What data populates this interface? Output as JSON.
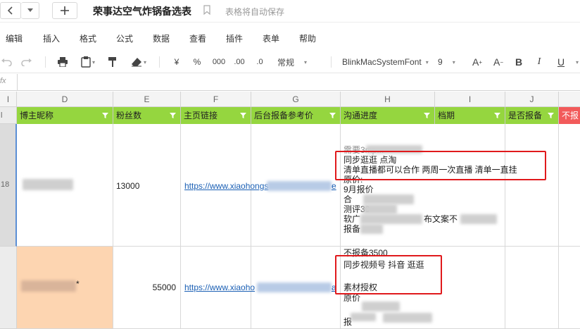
{
  "titlebar": {
    "doc_title": "荣事达空气炸锅备选表",
    "save_status": "表格将自动保存",
    "icons": [
      "chevron-left-icon",
      "chevron-down-icon",
      "plus-icon",
      "bookmark-icon"
    ]
  },
  "menu": [
    "编辑",
    "插入",
    "格式",
    "公式",
    "数据",
    "查看",
    "插件",
    "表单",
    "帮助"
  ],
  "toolbar": {
    "currency": "¥",
    "percent": "%",
    "thousands": "000",
    "decimal_inc": ".00",
    "decimal_dec": ".0",
    "number_format": "常规",
    "font_name": "BlinkMacSystemFont",
    "font_size": "9",
    "font_inc": "A",
    "font_dec": "A",
    "bold": "B",
    "italic": "I",
    "underline": "U"
  },
  "formula_bar": {
    "fx_label": "fx",
    "value": ""
  },
  "columns": [
    "D",
    "E",
    "F",
    "G",
    "H",
    "I",
    "J"
  ],
  "header_row": [
    "博主昵称",
    "粉丝数",
    "主页链接",
    "后台报备参考价",
    "沟通进度",
    "档期",
    "是否报备",
    "不报"
  ],
  "rows": [
    {
      "row_number": "18",
      "fans": "13000",
      "link": "https://www.xiaohongs",
      "link_end": "e",
      "notes": [
        "需要3mp...",
        "同步逛逛 点淘",
        "清单直播都可以合作 两周一次直播 清单一直挂",
        "原价:",
        "9月报价",
        "合",
        "测评30",
        "软广",
        "布文案不",
        "报备"
      ]
    },
    {
      "row_number": "",
      "nickname_suffix": "*",
      "fans": "55000",
      "link": "https://www.xiaoho",
      "link_end": "a",
      "notes": [
        "不报备3500",
        "同步视频号 抖音 逛逛",
        "",
        "素材授权",
        "原价",
        "报"
      ]
    }
  ],
  "colors": {
    "header_green": "#95d63f",
    "header_red": "#f25a5a",
    "highlight_peach": "#fdd5b1",
    "annotation_red": "#e0191c",
    "link_blue": "#1a5fb4"
  }
}
